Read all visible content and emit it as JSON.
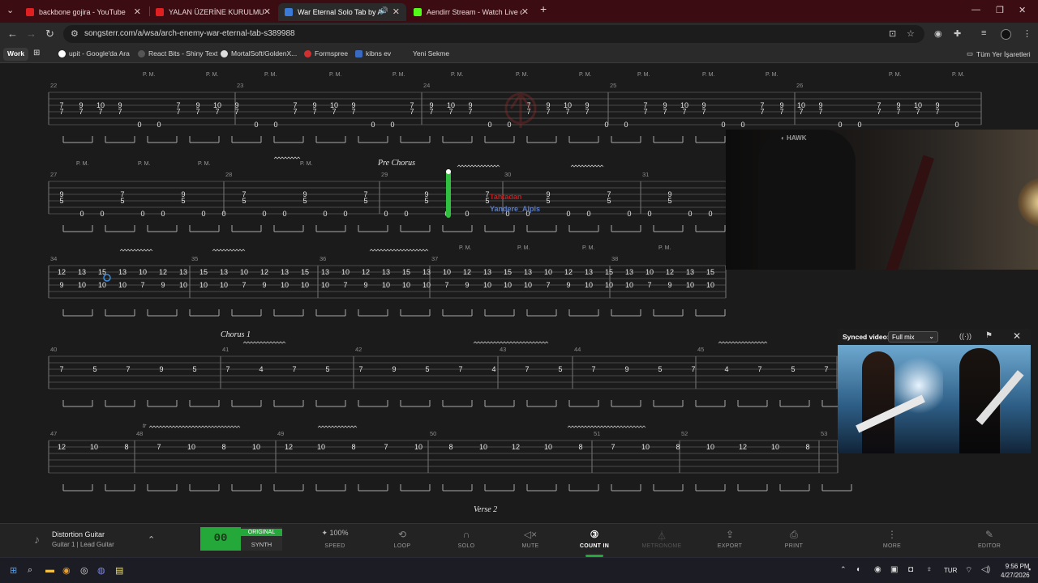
{
  "browser": {
    "tabs": [
      {
        "label": "backbone gojira - YouTube",
        "color": "#e02020"
      },
      {
        "label": "YALAN ÜZERİNE KURULMUŞ KA",
        "color": "#e02020"
      },
      {
        "label": "War Eternal Solo Tab by Arch",
        "color": "#3a7ad8"
      },
      {
        "label": "Aendirr Stream - Watch Live on",
        "color": "#53fc18"
      }
    ],
    "url": "songsterr.com/a/wsa/arch-enemy-war-eternal-tab-s389988",
    "profile_chip": "Work",
    "bookmarks": [
      {
        "label": "upit - Google'da Ara"
      },
      {
        "label": "React Bits - Shiny Text"
      },
      {
        "label": "MortalSoft/GoldenX..."
      },
      {
        "label": "Formspree"
      },
      {
        "label": "kibns ev"
      },
      {
        "label": "Yeni Sekme"
      }
    ],
    "all_bookmarks": "Tüm Yer İşaretleri"
  },
  "tab": {
    "bar_numbers": [
      "22",
      "23",
      "24",
      "25",
      "26",
      "27",
      "28",
      "29",
      "30",
      "31",
      "32",
      "33",
      "34",
      "35",
      "36",
      "37",
      "38",
      "40",
      "41",
      "42",
      "43",
      "44",
      "45",
      "46",
      "47",
      "48",
      "49",
      "50",
      "51",
      "52",
      "53"
    ],
    "pm": "P. M.",
    "pm_dashed": "P. M. - - - -|",
    "sections": {
      "pre_chorus": "Pre Chorus",
      "chorus": "Chorus 1",
      "verse": "Verse 2"
    },
    "tr": "tr",
    "stream_overlay_1": "Tahtadan",
    "stream_overlay_2": "Yandere_Alpis"
  },
  "synced_video": {
    "label": "Synced video:",
    "mode": "Full mix"
  },
  "player": {
    "instrument_name": "Distortion Guitar",
    "instrument_sub": "Guitar 1 | Lead Guitar",
    "toggle_value": "00",
    "original": "ORIGINAL",
    "synth": "SYNTH",
    "speed_value": "100%",
    "controls": [
      "SPEED",
      "LOOP",
      "SOLO",
      "MUTE",
      "COUNT IN",
      "METRONOME",
      "EXPORT",
      "PRINT",
      "MORE",
      "EDITOR"
    ]
  },
  "taskbar": {
    "lang": "TUR",
    "time": "9:56 PM",
    "date": "4/27/2026"
  }
}
